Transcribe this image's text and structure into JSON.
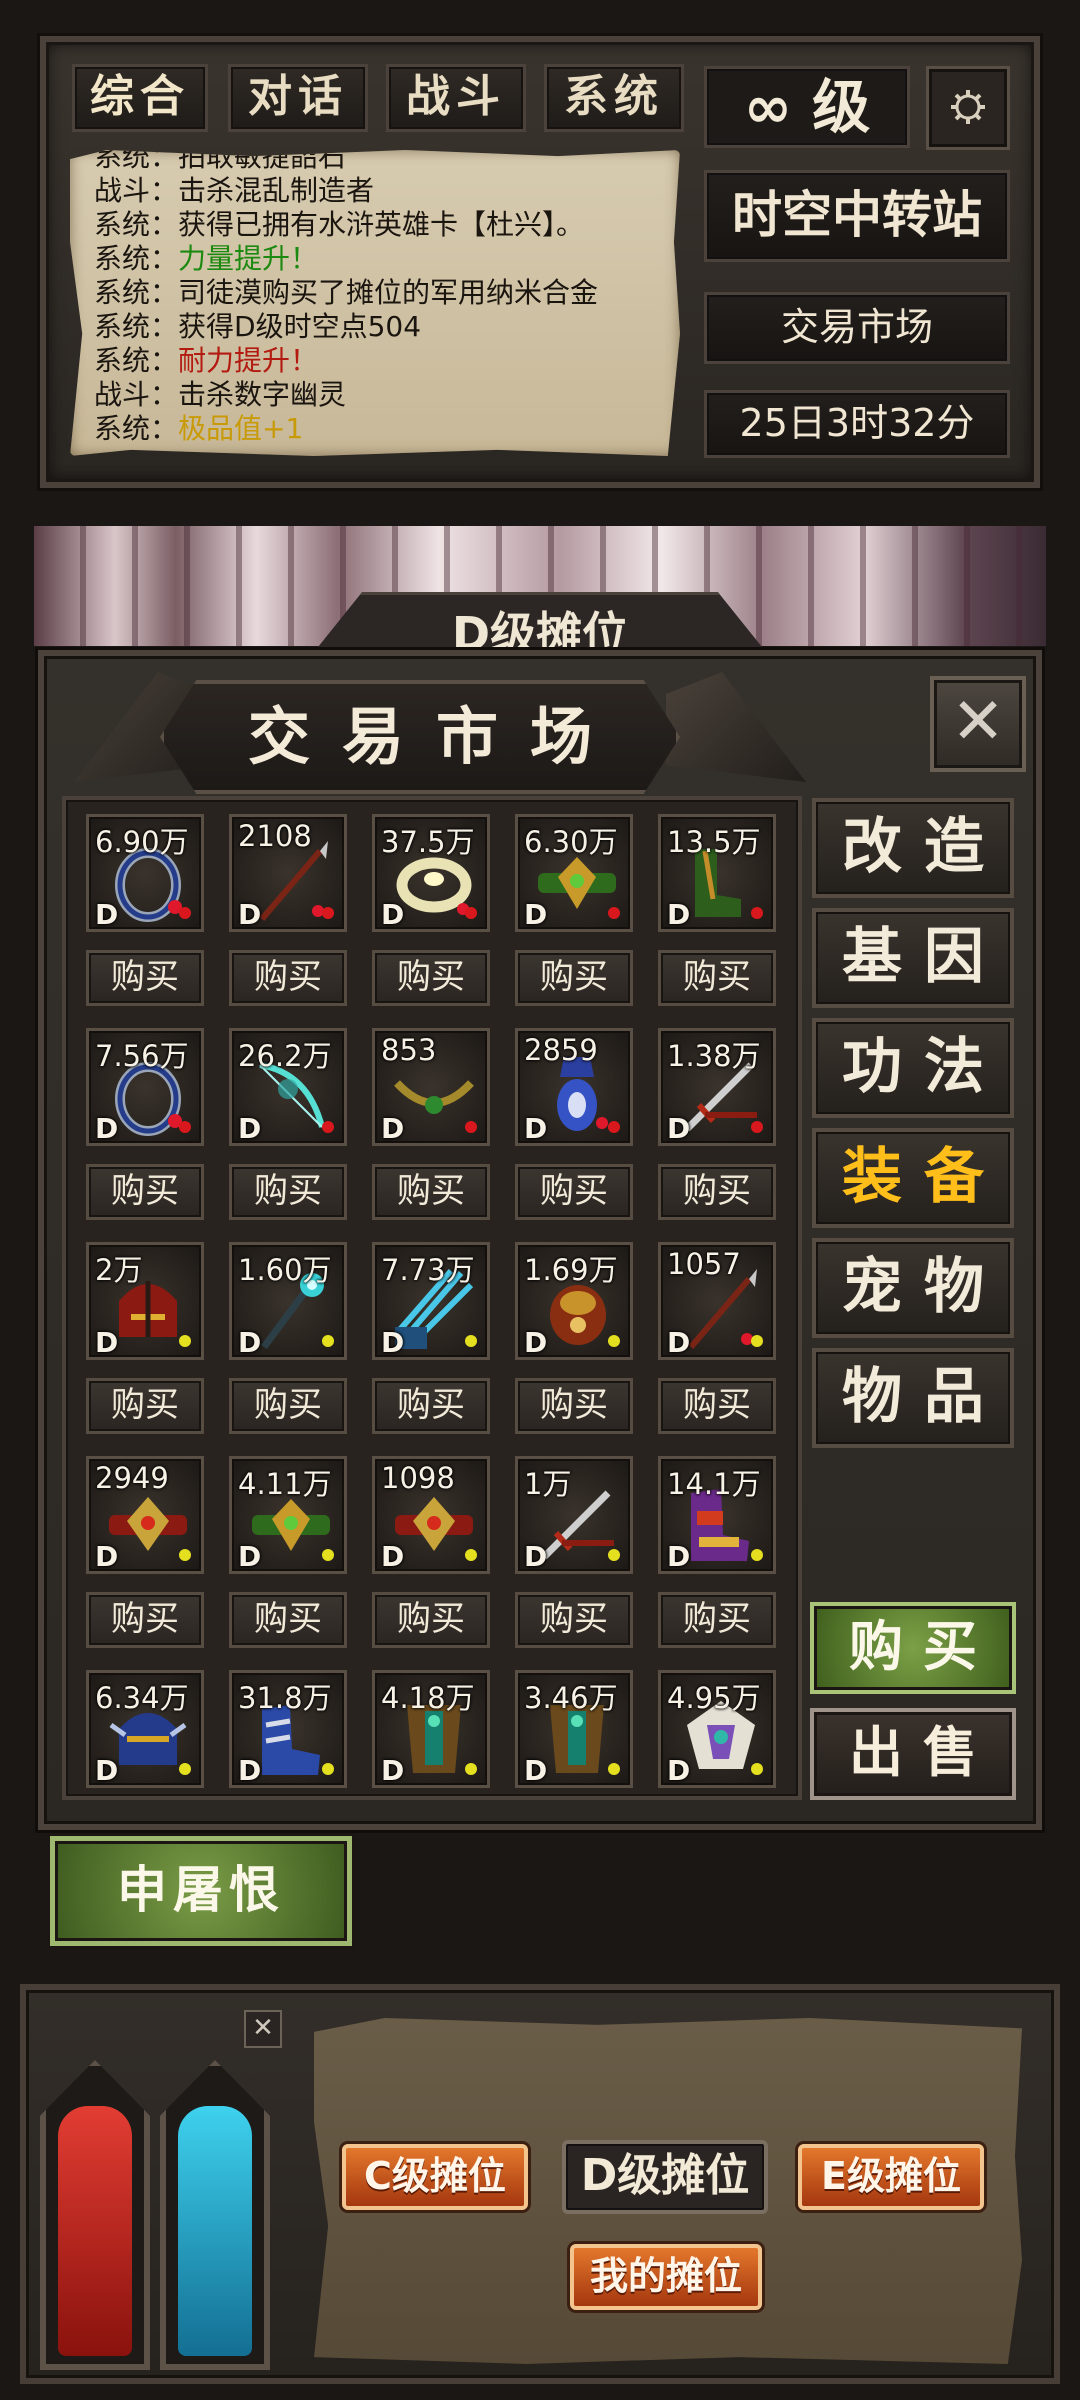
{
  "tabs": [
    "综合",
    "对话",
    "战斗",
    "系统"
  ],
  "level": "∞ 级",
  "chat": [
    {
      "prefix": "系统：",
      "text": "拍取敏捷韶石",
      "hl": "",
      "hlClass": ""
    },
    {
      "prefix": "战斗：",
      "text": "击杀混乱制造者",
      "hl": "",
      "hlClass": ""
    },
    {
      "prefix": "系统：",
      "text": "获得已拥有水浒英雄卡【杜兴】。",
      "hl": "",
      "hlClass": ""
    },
    {
      "prefix": "系统：",
      "text": "",
      "hl": "力量提升！",
      "hlClass": "hl-green"
    },
    {
      "prefix": "系统：",
      "text": "司徒漠购买了摊位的军用纳米合金",
      "hl": "",
      "hlClass": ""
    },
    {
      "prefix": "系统：",
      "text": "获得D级时空点504",
      "hl": "",
      "hlClass": ""
    },
    {
      "prefix": "系统：",
      "text": "",
      "hl": "耐力提升！",
      "hlClass": "hl-red"
    },
    {
      "prefix": "战斗：",
      "text": "击杀数字幽灵",
      "hl": "",
      "hlClass": ""
    },
    {
      "prefix": "系统：",
      "text": "",
      "hl": "极品值+1",
      "hlClass": "hl-yellow"
    }
  ],
  "location": "时空中转站",
  "market_label": "交易市场",
  "time": "25日3时32分",
  "d_stall_title": "D级摊位",
  "market_title": "交易市场",
  "close_icon": "✕",
  "buy_label": "购买",
  "items": [
    {
      "price": "6.90万",
      "grade": "D",
      "dot": "#d8181c",
      "icon": "ring-icon",
      "art": "ring-blue"
    },
    {
      "price": "2108",
      "grade": "D",
      "dot": "#d8181c",
      "icon": "spear-icon",
      "art": "spear"
    },
    {
      "price": "37.5万",
      "grade": "D",
      "dot": "#d8181c",
      "icon": "ring-icon",
      "art": "ring-gold"
    },
    {
      "price": "6.30万",
      "grade": "D",
      "dot": "#d8181c",
      "icon": "belt-icon",
      "art": "belt-green"
    },
    {
      "price": "13.5万",
      "grade": "D",
      "dot": "#d8181c",
      "icon": "boots-icon",
      "art": "boots-green"
    },
    {
      "price": "7.56万",
      "grade": "D",
      "dot": "#d8181c",
      "icon": "ring-icon",
      "art": "ring-blue"
    },
    {
      "price": "26.2万",
      "grade": "D",
      "dot": "#d8181c",
      "icon": "bow-icon",
      "art": "bow"
    },
    {
      "price": "853",
      "grade": "D",
      "dot": "#d8181c",
      "icon": "necklace-icon",
      "art": "necklace"
    },
    {
      "price": "2859",
      "grade": "D",
      "dot": "#d8181c",
      "icon": "amulet-icon",
      "art": "amulet"
    },
    {
      "price": "1.38万",
      "grade": "D",
      "dot": "#d8181c",
      "icon": "sword-icon",
      "art": "sword"
    },
    {
      "price": "2万",
      "grade": "D",
      "dot": "#e4e020",
      "icon": "helmet-icon",
      "art": "helmet"
    },
    {
      "price": "1.60万",
      "grade": "D",
      "dot": "#e4e020",
      "icon": "staff-icon",
      "art": "staff"
    },
    {
      "price": "7.73万",
      "grade": "D",
      "dot": "#e4e020",
      "icon": "claw-icon",
      "art": "claw"
    },
    {
      "price": "1.69万",
      "grade": "D",
      "dot": "#e4e020",
      "icon": "gauntlet-icon",
      "art": "gauntlet"
    },
    {
      "price": "1057",
      "grade": "D",
      "dot": "#e4e020",
      "icon": "spear-icon",
      "art": "spear"
    },
    {
      "price": "2949",
      "grade": "D",
      "dot": "#e4e020",
      "icon": "belt-icon",
      "art": "belt-red"
    },
    {
      "price": "4.11万",
      "grade": "D",
      "dot": "#e4e020",
      "icon": "belt-icon",
      "art": "belt-green"
    },
    {
      "price": "1098",
      "grade": "D",
      "dot": "#e4e020",
      "icon": "belt-icon",
      "art": "belt-red"
    },
    {
      "price": "1万",
      "grade": "D",
      "dot": "#e4e020",
      "icon": "sword-icon",
      "art": "sword"
    },
    {
      "price": "14.1万",
      "grade": "D",
      "dot": "#e4e020",
      "icon": "boots-icon",
      "art": "boots-purple"
    },
    {
      "price": "6.34万",
      "grade": "D",
      "dot": "#e4e020",
      "icon": "helmet-icon",
      "art": "helmet-blue"
    },
    {
      "price": "31.8万",
      "grade": "D",
      "dot": "#e4e020",
      "icon": "boots-icon",
      "art": "boots-blue"
    },
    {
      "price": "4.18万",
      "grade": "D",
      "dot": "#e4e020",
      "icon": "armor-icon",
      "art": "armor"
    },
    {
      "price": "3.46万",
      "grade": "D",
      "dot": "#e4e020",
      "icon": "armor-icon",
      "art": "armor"
    },
    {
      "price": "4.95万",
      "grade": "D",
      "dot": "#e4e020",
      "icon": "armor-icon",
      "art": "armor-white"
    }
  ],
  "categories": [
    {
      "label": "改造",
      "active": false
    },
    {
      "label": "基因",
      "active": false
    },
    {
      "label": "功法",
      "active": false
    },
    {
      "label": "装备",
      "active": true
    },
    {
      "label": "宠物",
      "active": false
    },
    {
      "label": "物品",
      "active": false
    }
  ],
  "action_buy": "购买",
  "action_sell": "出售",
  "seller_name": "申屠恨",
  "stalls": {
    "c": "C级摊位",
    "d": "D级摊位",
    "e": "E级摊位",
    "mine": "我的摊位"
  },
  "colors": {
    "hp": "#c82620",
    "mp": "#23a7c9",
    "accent_gold": "#ffbe1a"
  }
}
